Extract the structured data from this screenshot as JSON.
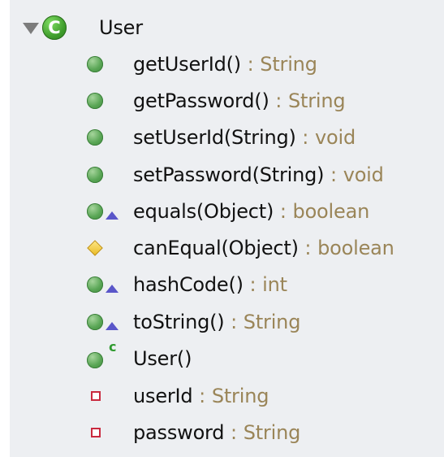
{
  "outline": {
    "class_name": "User",
    "class_badge": "C",
    "members": [
      {
        "kind": "method",
        "icon": "public-method-icon",
        "name": "getUserId()",
        "type": "String"
      },
      {
        "kind": "method",
        "icon": "public-method-icon",
        "name": "getPassword()",
        "type": "String"
      },
      {
        "kind": "method",
        "icon": "public-method-icon",
        "name": "setUserId(String)",
        "type": "void"
      },
      {
        "kind": "method",
        "icon": "public-method-icon",
        "name": "setPassword(String)",
        "type": "void"
      },
      {
        "kind": "method",
        "icon": "override-public-method-icon",
        "name": "equals(Object)",
        "type": "boolean"
      },
      {
        "kind": "method",
        "icon": "protected-method-icon",
        "name": "canEqual(Object)",
        "type": "boolean"
      },
      {
        "kind": "method",
        "icon": "override-public-method-icon",
        "name": "hashCode()",
        "type": "int"
      },
      {
        "kind": "method",
        "icon": "override-public-method-icon",
        "name": "toString()",
        "type": "String"
      },
      {
        "kind": "constructor",
        "icon": "constructor-icon",
        "name": "User()",
        "marker": "c"
      },
      {
        "kind": "field",
        "icon": "private-field-icon",
        "name": "userId",
        "type": "String"
      },
      {
        "kind": "field",
        "icon": "private-field-icon",
        "name": "password",
        "type": "String"
      }
    ],
    "separator": " : "
  }
}
